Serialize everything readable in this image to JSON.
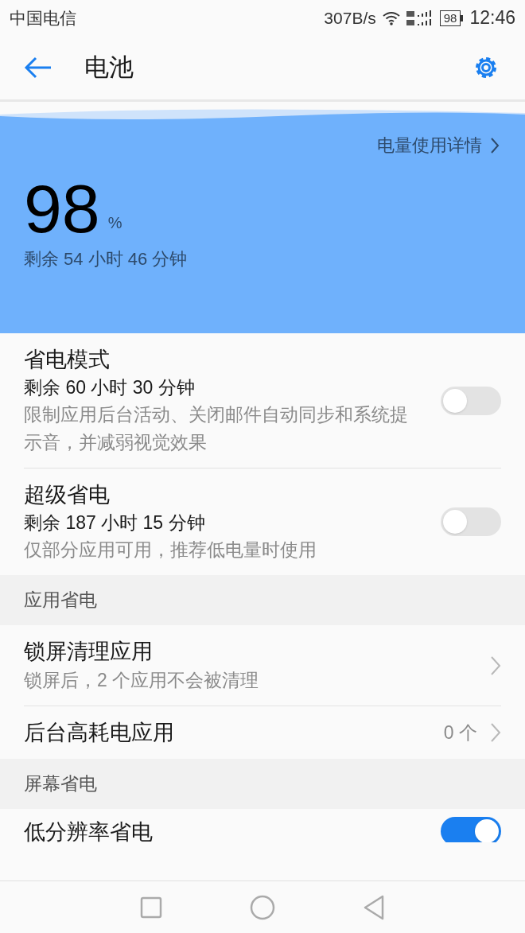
{
  "status_bar": {
    "carrier": "中国电信",
    "speed": "307B/s",
    "battery": "98",
    "time": "12:46"
  },
  "header": {
    "title": "电池"
  },
  "battery_panel": {
    "details_link": "电量使用详情",
    "percent": "98",
    "percent_unit": "%",
    "remaining": "剩余 54 小时 46 分钟"
  },
  "sections": [
    {
      "items": [
        {
          "kind": "toggle",
          "title": "省电模式",
          "subtitle": "剩余 60 小时 30 分钟",
          "description": "限制应用后台活动、关闭邮件自动同步和系统提示音，并减弱视觉效果",
          "on": false
        },
        {
          "kind": "toggle",
          "title": "超级省电",
          "subtitle": "剩余 187 小时 15 分钟",
          "description": "仅部分应用可用，推荐低电量时使用",
          "on": false
        }
      ]
    },
    {
      "header": "应用省电",
      "items": [
        {
          "kind": "link",
          "title": "锁屏清理应用",
          "description": "锁屏后，2 个应用不会被清理"
        },
        {
          "kind": "link",
          "title": "后台高耗电应用",
          "value": "0 个"
        }
      ]
    },
    {
      "header": "屏幕省电",
      "items": [
        {
          "kind": "toggle",
          "title": "低分辨率省电",
          "on": true
        }
      ]
    }
  ]
}
